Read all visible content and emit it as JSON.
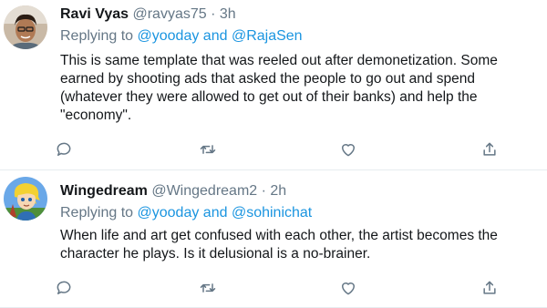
{
  "tweets": [
    {
      "name": "Ravi Vyas",
      "handle": "@ravyas75",
      "separator": "·",
      "time": "3h",
      "replying_prefix": "Replying to",
      "replying_user1": "@yooday",
      "replying_and": "and",
      "replying_user2": "@RajaSen",
      "text_lines": [
        "This is same template that was reeled out after demonetization. Some",
        "earned by shooting ads that asked the people to go out and spend",
        "(whatever they were allowed to get out of their banks) and help the",
        "\"economy\"."
      ]
    },
    {
      "name": "Wingedream",
      "handle": "@Wingedream2",
      "separator": "·",
      "time": "2h",
      "replying_prefix": "Replying to",
      "replying_user1": "@yooday",
      "replying_and": "and",
      "replying_user2": "@sohinichat",
      "text_lines": [
        "When life and art get confused with each other, the artist becomes the",
        "character he plays. Is it delusional is a no-brainer."
      ]
    }
  ],
  "icons": {
    "reply": "reply-icon",
    "retweet": "retweet-icon",
    "like": "heart-icon",
    "share": "share-icon"
  },
  "colors": {
    "text": "#14171a",
    "secondary": "#657786",
    "link": "#1b95e0",
    "divider": "#e6ecf0"
  }
}
